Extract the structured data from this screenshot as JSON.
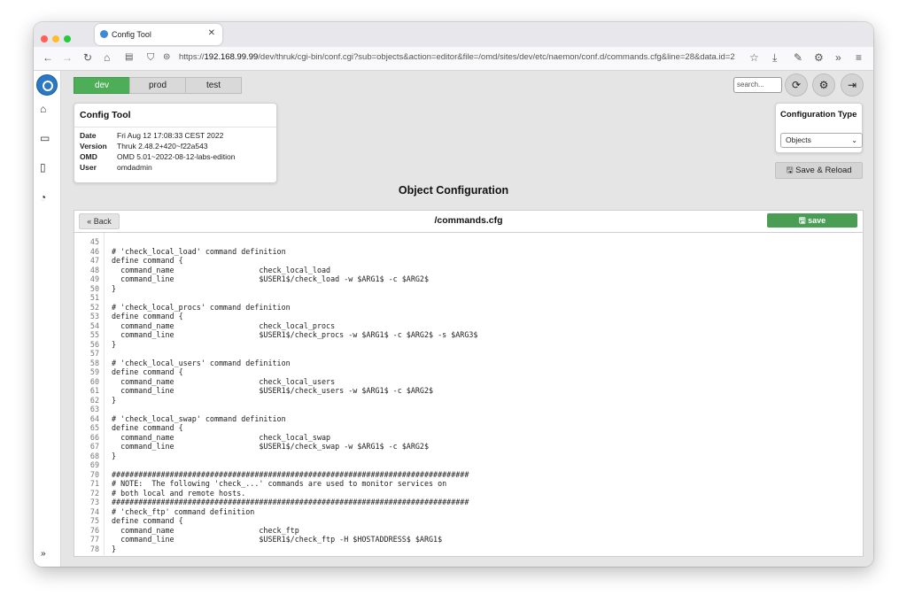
{
  "colors": {
    "accent": "#4eae58",
    "save": "#4a9e53",
    "dot_close": "#ff5f57",
    "dot_min": "#febc2e",
    "dot_max": "#28c840",
    "logo": "#2b78c4"
  },
  "browser": {
    "tab_title": "Config Tool",
    "url_prefix": "https://",
    "url_host": "192.168.99.99",
    "url_rest": "/dev/thruk/cgi-bin/conf.cgi?sub=objects&action=editor&file=/omd/sites/dev/etc/naemon/conf.d/commands.cfg&line=28&data.id=2",
    "icons": [
      "back-icon",
      "forward-icon",
      "reload-icon",
      "home-icon",
      "tracking-icon",
      "shield-icon",
      "lock-icon",
      "bookmark-icon",
      "download-icon",
      "wrench-icon",
      "gear-icon",
      "overflow-icon",
      "menu-icon"
    ]
  },
  "sidebar": {
    "icons": [
      "home-icon",
      "monitor-icon",
      "book-icon",
      "gauge-icon"
    ],
    "expand": "»"
  },
  "env_tabs": [
    {
      "label": "dev",
      "active": true
    },
    {
      "label": "prod",
      "active": false
    },
    {
      "label": "test",
      "active": false
    }
  ],
  "header": {
    "search_placeholder": "search..."
  },
  "config_tool": {
    "title": "Config Tool",
    "rows": [
      {
        "key": "Date",
        "value": "Fri Aug 12 17:08:33 CEST 2022"
      },
      {
        "key": "Version",
        "value": "Thruk 2.48.2+420~f22a543"
      },
      {
        "key": "OMD",
        "value": "OMD 5.01~2022-08-12-labs-edition"
      },
      {
        "key": "User",
        "value": "omdadmin"
      }
    ]
  },
  "config_type": {
    "title": "Configuration Type",
    "selected": "Objects"
  },
  "save_reload": "Save & Reload",
  "page_title": "Object Configuration",
  "editor": {
    "back_label": "Back",
    "filename": "/commands.cfg",
    "save_label": "save",
    "lines": [
      {
        "n": "45",
        "t": ""
      },
      {
        "n": "46",
        "t": "# 'check_local_load' command definition"
      },
      {
        "n": "47",
        "t": "define command {"
      },
      {
        "n": "48",
        "t": "  command_name                   check_local_load"
      },
      {
        "n": "49",
        "t": "  command_line                   $USER1$/check_load -w $ARG1$ -c $ARG2$"
      },
      {
        "n": "50",
        "t": "}"
      },
      {
        "n": "51",
        "t": ""
      },
      {
        "n": "52",
        "t": "# 'check_local_procs' command definition"
      },
      {
        "n": "53",
        "t": "define command {"
      },
      {
        "n": "54",
        "t": "  command_name                   check_local_procs"
      },
      {
        "n": "55",
        "t": "  command_line                   $USER1$/check_procs -w $ARG1$ -c $ARG2$ -s $ARG3$"
      },
      {
        "n": "56",
        "t": "}"
      },
      {
        "n": "57",
        "t": ""
      },
      {
        "n": "58",
        "t": "# 'check_local_users' command definition"
      },
      {
        "n": "59",
        "t": "define command {"
      },
      {
        "n": "60",
        "t": "  command_name                   check_local_users"
      },
      {
        "n": "61",
        "t": "  command_line                   $USER1$/check_users -w $ARG1$ -c $ARG2$"
      },
      {
        "n": "62",
        "t": "}"
      },
      {
        "n": "63",
        "t": ""
      },
      {
        "n": "64",
        "t": "# 'check_local_swap' command definition"
      },
      {
        "n": "65",
        "t": "define command {"
      },
      {
        "n": "66",
        "t": "  command_name                   check_local_swap"
      },
      {
        "n": "67",
        "t": "  command_line                   $USER1$/check_swap -w $ARG1$ -c $ARG2$"
      },
      {
        "n": "68",
        "t": "}"
      },
      {
        "n": "69",
        "t": ""
      },
      {
        "n": "70",
        "t": "################################################################################"
      },
      {
        "n": "71",
        "t": "# NOTE:  The following 'check_...' commands are used to monitor services on"
      },
      {
        "n": "72",
        "t": "# both local and remote hosts."
      },
      {
        "n": "73",
        "t": "################################################################################"
      },
      {
        "n": "74",
        "t": "# 'check_ftp' command definition"
      },
      {
        "n": "75",
        "t": "define command {"
      },
      {
        "n": "76",
        "t": "  command_name                   check_ftp"
      },
      {
        "n": "77",
        "t": "  command_line                   $USER1$/check_ftp -H $HOSTADDRESS$ $ARG1$"
      },
      {
        "n": "78",
        "t": "}"
      }
    ]
  }
}
